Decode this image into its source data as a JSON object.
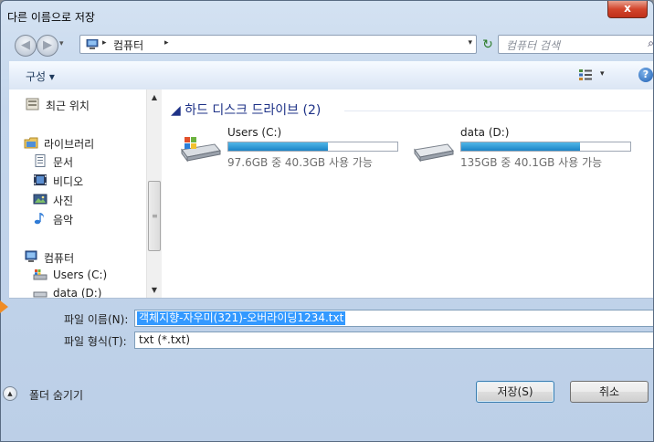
{
  "window": {
    "title": "다른 이름으로 저장",
    "close_label": "x"
  },
  "nav": {
    "back_glyph": "◀",
    "forward_glyph": "▶",
    "history_drop_glyph": "▾",
    "address_icon": "computer-icon",
    "address_sep": "▸",
    "address_path": "컴퓨터",
    "address_drop_glyph": "▾",
    "refresh_glyph": "↻",
    "search_placeholder": "컴퓨터 검색",
    "search_icon_glyph": "⌕"
  },
  "toolbar": {
    "organize_label": "구성 ▾",
    "view_drop_glyph": "▾",
    "help_glyph": "?"
  },
  "sidebar": {
    "items": [
      {
        "label": "최근 위치",
        "icon": "recent-places-icon"
      },
      {
        "label": "라이브러리",
        "icon": "libraries-icon"
      },
      {
        "label": "문서",
        "icon": "documents-icon"
      },
      {
        "label": "비디오",
        "icon": "videos-icon"
      },
      {
        "label": "사진",
        "icon": "pictures-icon"
      },
      {
        "label": "음악",
        "icon": "music-icon"
      },
      {
        "label": "컴퓨터",
        "icon": "computer-icon"
      },
      {
        "label": "Users (C:)",
        "icon": "drive-c-icon"
      },
      {
        "label": "data (D:)",
        "icon": "drive-d-icon"
      }
    ]
  },
  "drives": {
    "group_title": "◢ 하드 디스크 드라이브 (2)",
    "items": [
      {
        "name": "Users (C:)",
        "info": "97.6GB 중 40.3GB 사용 가능",
        "used_fraction": 0.59
      },
      {
        "name": "data (D:)",
        "info": "135GB 중 40.1GB 사용 가능",
        "used_fraction": 0.7
      }
    ]
  },
  "form": {
    "filename_label": "파일 이름(N):",
    "filename_value": "객체지향-자우미(321)-오버라이딩1234.txt",
    "filetype_label": "파일 형식(T):",
    "filetype_value": "txt (*.txt)",
    "combo_drop_glyph": "▼",
    "hide_folders_label": "폴더 숨기기",
    "hide_folders_glyph": "▲",
    "save_label": "저장(S)",
    "cancel_label": "취소"
  },
  "scrollbar": {
    "up_glyph": "▲",
    "down_glyph": "▼",
    "grip_glyph": "≡"
  }
}
